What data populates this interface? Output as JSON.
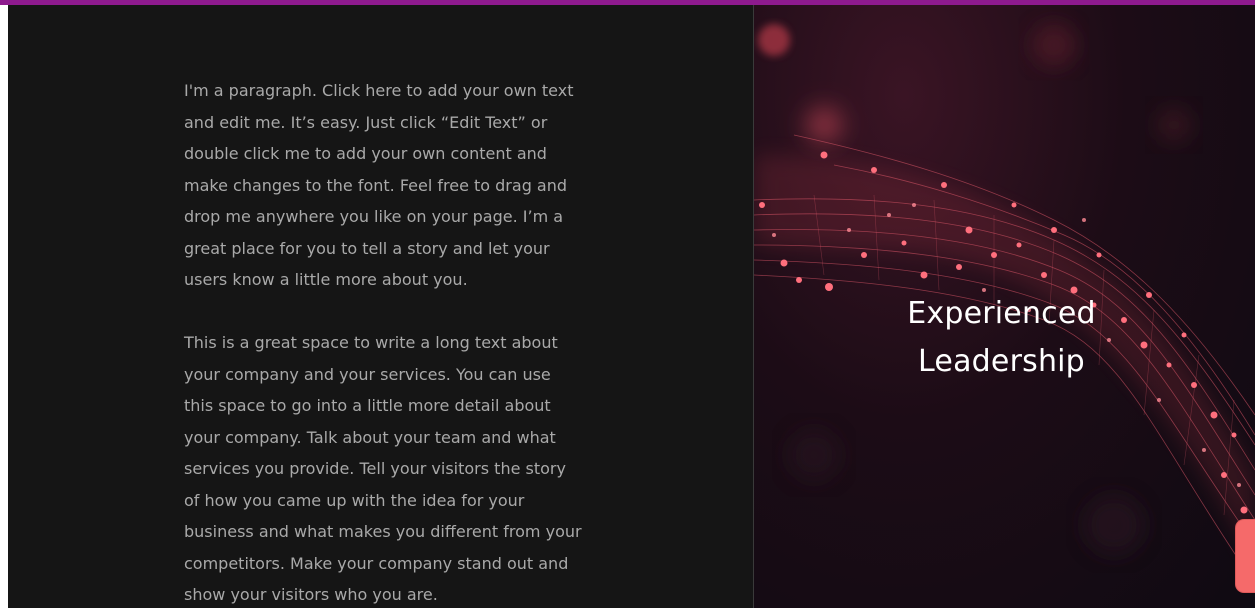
{
  "content": {
    "paragraph_1": "I'm a paragraph. Click here to add your own text and edit me. It’s easy. Just click “Edit Text” or double click me to add your own content and make changes to the font. Feel free to drag and drop me anywhere you like on your page. I’m a great place for you to tell a story and let your users know a little more about you.",
    "paragraph_2": "This is a great space to write a long text about your company and your services. You can use this space to go into a little more detail about your company. Talk about your team and what services you provide. Tell your visitors the story of how you came up with the idea for your business and what makes you different from your competitors. Make your company stand out and show your visitors who you are."
  },
  "hero": {
    "heading_line_1": "Experienced",
    "heading_line_2": "Leadership",
    "image_icon": "red-particle-wave-image"
  },
  "side_tab": {
    "icon": "chat-tab-icon"
  },
  "colors": {
    "top_border": "#8e1a8e",
    "background": "#151515",
    "body_text": "#a9a9a9",
    "heading_text": "#ffffff",
    "accent": "#f56a6a"
  }
}
